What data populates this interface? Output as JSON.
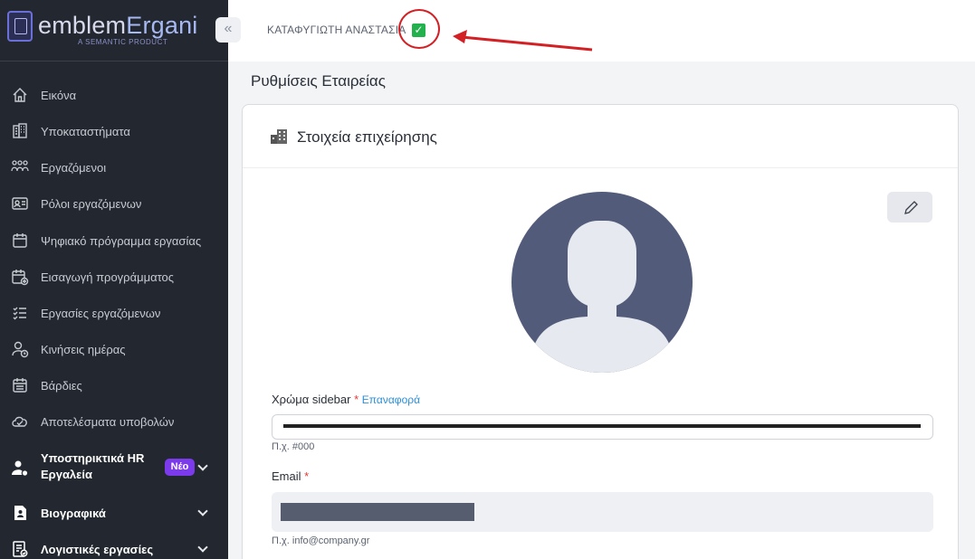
{
  "brand": {
    "name_part1": "emblem",
    "name_part2": "Ergani",
    "subtitle": "A SEMANTIC PRODUCT"
  },
  "sidebar": {
    "collapse_glyph": "«",
    "items": [
      {
        "label": "Εικόνα",
        "icon": "home-icon"
      },
      {
        "label": "Υποκαταστήματα",
        "icon": "building-icon"
      },
      {
        "label": "Εργαζόμενοι",
        "icon": "users-icon"
      },
      {
        "label": "Ρόλοι εργαζόμενων",
        "icon": "id-card-icon"
      },
      {
        "label": "Ψηφιακό πρόγραμμα εργασίας",
        "icon": "calendar-icon"
      },
      {
        "label": "Εισαγωγή προγράμματος",
        "icon": "calendar-add-icon"
      },
      {
        "label": "Εργασίες εργαζόμενων",
        "icon": "task-list-icon"
      },
      {
        "label": "Κινήσεις ημέρας",
        "icon": "user-clock-icon"
      },
      {
        "label": "Βάρδιες",
        "icon": "shift-calendar-icon"
      },
      {
        "label": "Αποτελέσματα υποβολών",
        "icon": "cloud-check-icon"
      }
    ],
    "hr_tools": {
      "label": "Υποστηρικτικά HR Εργαλεία",
      "badge": "Νέο"
    },
    "cv": {
      "label": "Βιογραφικά"
    },
    "accounting": {
      "label": "Λογιστικές εργασίες"
    }
  },
  "topbar": {
    "company": "ΚΑΤΑΦΥΓΙΩΤΗ ΑΝΑΣΤΑΣΙΑ",
    "check": "✓"
  },
  "page": {
    "title": "Ρυθμίσεις Εταιρείας"
  },
  "card": {
    "title": "Στοιχεία επιχείρησης"
  },
  "form": {
    "sidebar_color": {
      "label": "Χρώμα sidebar",
      "required": "*",
      "reset": "Επαναφορά",
      "hint": "Π.χ. #000"
    },
    "email": {
      "label": "Email",
      "required": "*",
      "hint": "Π.χ. info@company.gr"
    }
  },
  "colors": {
    "sidebar_bg": "#232830",
    "accent": "#7c3aed",
    "link": "#2b8fd8",
    "annotation": "#d32025",
    "check": "#22b14c",
    "avatar": "#525c7a"
  }
}
